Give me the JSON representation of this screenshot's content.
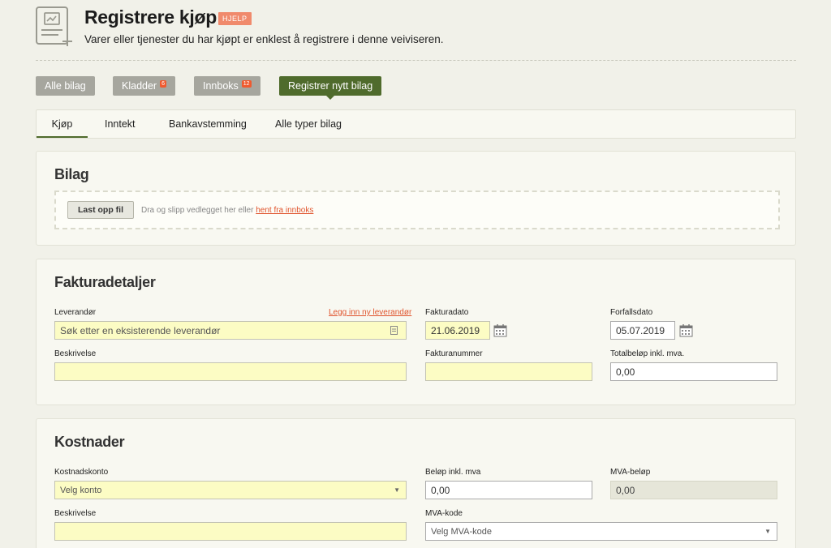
{
  "header": {
    "title": "Registrere kjøp",
    "help_label": "HJELP",
    "subtitle": "Varer eller tjenester du har kjøpt er enklest å registrere i denne veiviseren."
  },
  "top_nav": {
    "all_vouchers": "Alle bilag",
    "drafts": "Kladder",
    "drafts_count": "6",
    "inbox": "Innboks",
    "inbox_count": "12",
    "register_new": "Registrer nytt bilag"
  },
  "tabs": {
    "purchase": "Kjøp",
    "income": "Inntekt",
    "bank": "Bankavstemming",
    "all_types": "Alle typer bilag"
  },
  "voucher": {
    "title": "Bilag",
    "upload_button": "Last opp fil",
    "drop_text": "Dra og slipp vedlegget her eller",
    "inbox_link": "hent fra innboks"
  },
  "invoice": {
    "title": "Fakturadetaljer",
    "supplier_label": "Leverandør",
    "new_supplier_link": "Legg inn ny leverandør",
    "supplier_placeholder": "Søk etter en eksisterende leverandør",
    "invoice_date_label": "Fakturadato",
    "invoice_date_value": "21.06.2019",
    "due_date_label": "Forfallsdato",
    "due_date_value": "05.07.2019",
    "description_label": "Beskrivelse",
    "invoice_number_label": "Fakturanummer",
    "total_label": "Totalbeløp inkl. mva.",
    "total_value": "0,00"
  },
  "costs": {
    "title": "Kostnader",
    "account_label": "Kostnadskonto",
    "account_value": "Velg konto",
    "amount_label": "Beløp inkl. mva",
    "amount_value": "0,00",
    "vat_amount_label": "MVA-beløp",
    "vat_amount_value": "0,00",
    "description_label": "Beskrivelse",
    "vat_code_label": "MVA-kode",
    "vat_code_value": "Velg MVA-kode"
  }
}
